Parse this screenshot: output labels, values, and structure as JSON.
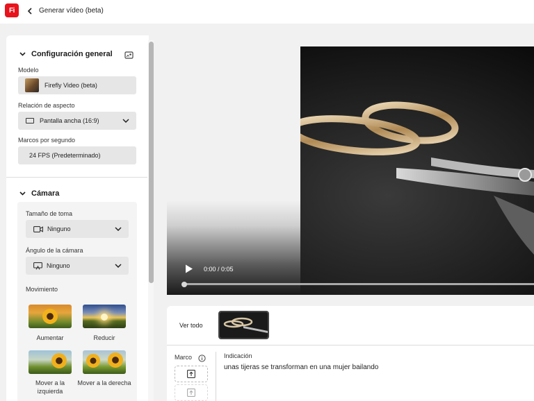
{
  "app": {
    "logo_text": "Fi",
    "brand_color": "#e8131c"
  },
  "header": {
    "title": "Generar vídeo (beta)"
  },
  "general": {
    "heading": "Configuración general",
    "model_label": "Modelo",
    "model_value": "Firefly Video (beta)",
    "aspect_label": "Relación de aspecto",
    "aspect_value": "Pantalla ancha (16:9)",
    "fps_label": "Marcos por segundo",
    "fps_value": "24 FPS (Predeterminado)"
  },
  "camera": {
    "heading": "Cámara",
    "shot_size_label": "Tamaño de toma",
    "shot_size_value": "Ninguno",
    "angle_label": "Ángulo de la cámara",
    "angle_value": "Ninguno",
    "motion_label": "Movimiento",
    "motions": [
      {
        "label": "Aumentar"
      },
      {
        "label": "Reducir"
      },
      {
        "label": "Mover a la izquierda"
      },
      {
        "label": "Mover a la derecha"
      }
    ]
  },
  "player": {
    "time": "0:00 / 0:05",
    "progress": 0
  },
  "history": {
    "view_all": "Ver todo"
  },
  "frame": {
    "label": "Marco"
  },
  "prompt": {
    "label": "Indicación",
    "text": "unas tijeras se transforman en una mujer bailando"
  }
}
